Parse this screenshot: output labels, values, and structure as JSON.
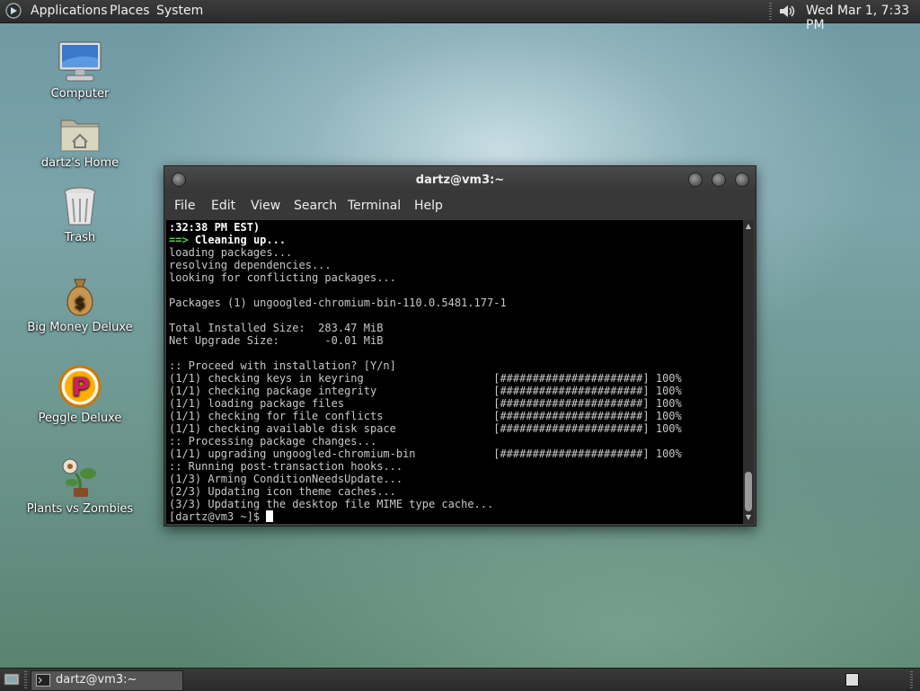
{
  "top_panel": {
    "menus": [
      "Applications",
      "Places",
      "System"
    ],
    "clock": "Wed Mar 1, 7:33 PM"
  },
  "desktop_icons": [
    {
      "label": "Computer",
      "icon": "computer-icon"
    },
    {
      "label": "dartz's Home",
      "icon": "home-folder-icon"
    },
    {
      "label": "Trash",
      "icon": "trash-icon"
    },
    {
      "label": "Big Money Deluxe",
      "icon": "money-bag-icon"
    },
    {
      "label": "Peggle Deluxe",
      "icon": "peggle-icon"
    },
    {
      "label": "Plants vs Zombies",
      "icon": "plants-vs-zombies-icon"
    }
  ],
  "terminal": {
    "title": "dartz@vm3:~",
    "menu": [
      "File",
      "Edit",
      "View",
      "Search",
      "Terminal",
      "Help"
    ],
    "lines": [
      ":32:38 PM EST)",
      "==> Cleaning up...",
      "loading packages...",
      "resolving dependencies...",
      "looking for conflicting packages...",
      "",
      "Packages (1) ungoogled-chromium-bin-110.0.5481.177-1",
      "",
      "Total Installed Size:  283.47 MiB",
      "Net Upgrade Size:       -0.01 MiB",
      "",
      ":: Proceed with installation? [Y/n]",
      "(1/1) checking keys in keyring                    [######################] 100%",
      "(1/1) checking package integrity                  [######################] 100%",
      "(1/1) loading package files                       [######################] 100%",
      "(1/1) checking for file conflicts                 [######################] 100%",
      "(1/1) checking available disk space               [######################] 100%",
      ":: Processing package changes...",
      "(1/1) upgrading ungoogled-chromium-bin            [######################] 100%",
      ":: Running post-transaction hooks...",
      "(1/3) Arming ConditionNeedsUpdate...",
      "(2/3) Updating icon theme caches...",
      "(3/3) Updating the desktop file MIME type cache...",
      "[dartz@vm3 ~]$ "
    ]
  },
  "taskbar": {
    "window_button": "dartz@vm3:~"
  },
  "colors": {
    "panel": "#2f2f2f",
    "terminal_bg": "#000000",
    "prompt_arrow": "#4fd04f"
  }
}
